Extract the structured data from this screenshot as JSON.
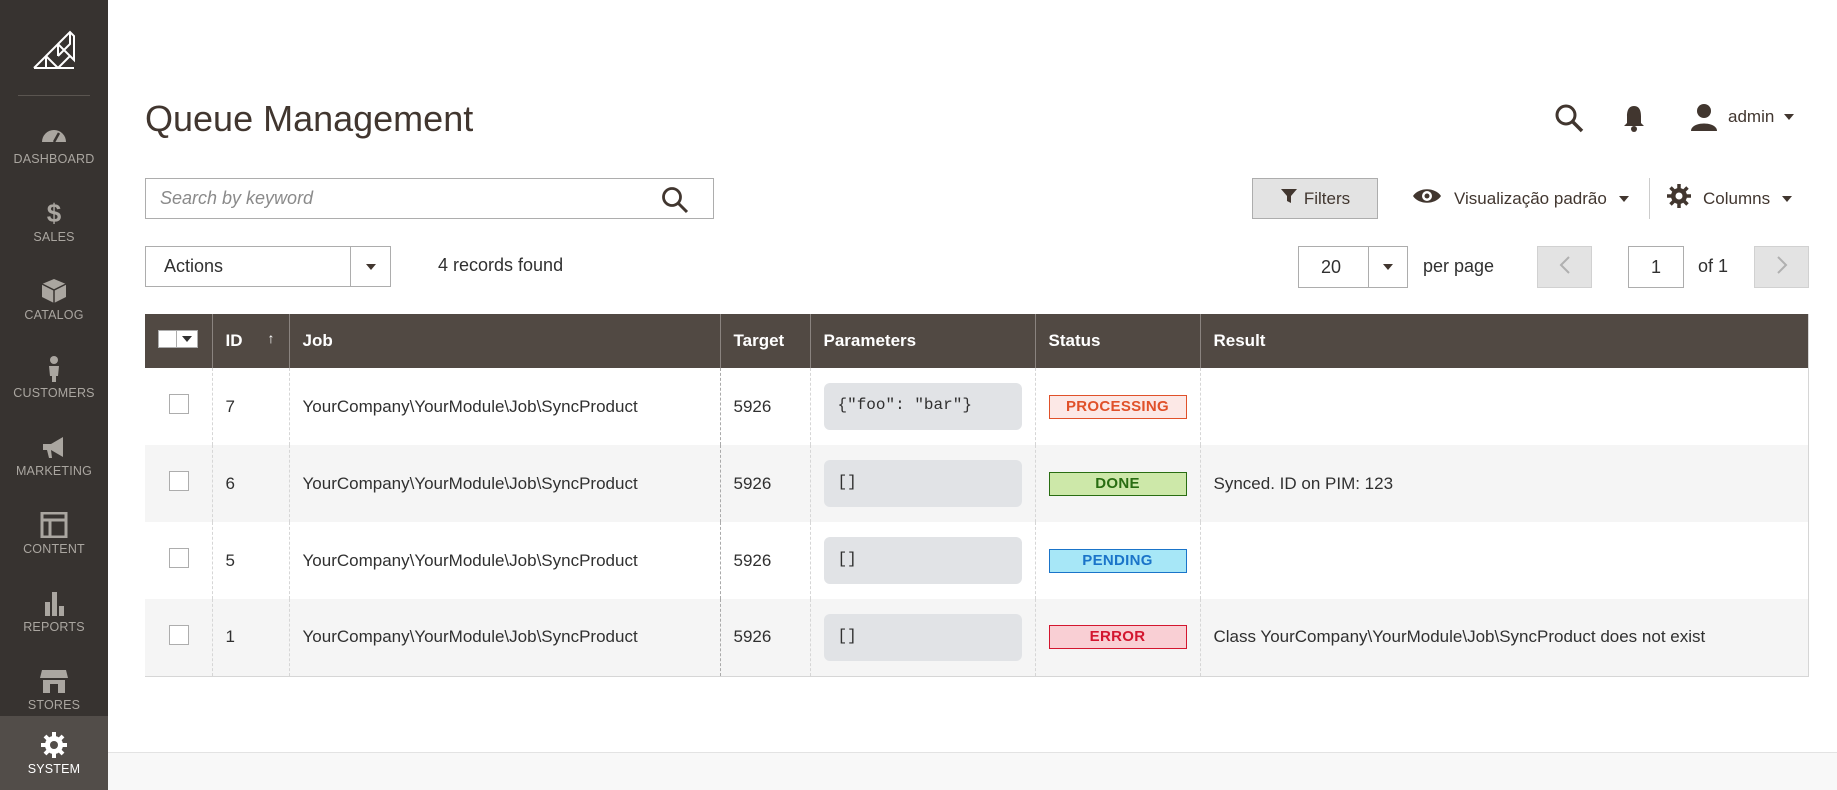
{
  "sidebar": {
    "items": [
      {
        "label": "DASHBOARD",
        "icon": "speedometer-icon"
      },
      {
        "label": "SALES",
        "icon": "dollar-icon"
      },
      {
        "label": "CATALOG",
        "icon": "box-icon"
      },
      {
        "label": "CUSTOMERS",
        "icon": "person-icon"
      },
      {
        "label": "MARKETING",
        "icon": "megaphone-icon"
      },
      {
        "label": "CONTENT",
        "icon": "layout-icon"
      },
      {
        "label": "REPORTS",
        "icon": "bar-chart-icon"
      },
      {
        "label": "STORES",
        "icon": "storefront-icon"
      },
      {
        "label": "SYSTEM",
        "icon": "gear-icon",
        "active": true
      }
    ]
  },
  "header": {
    "title": "Queue Management",
    "user": "admin"
  },
  "toolbar": {
    "search_placeholder": "Search by keyword",
    "filters_label": "Filters",
    "view_label": "Visualização padrão",
    "columns_label": "Columns",
    "actions_label": "Actions",
    "records_found": "4 records found",
    "per_page_value": "20",
    "per_page_label": "per page",
    "page_value": "1",
    "page_of": "of 1"
  },
  "grid": {
    "columns": [
      "ID",
      "Job",
      "Target",
      "Parameters",
      "Status",
      "Result"
    ],
    "rows": [
      {
        "id": "7",
        "job": "YourCompany\\YourModule\\Job\\SyncProduct",
        "target": "5926",
        "params": "{\"foo\": \"bar\"}",
        "status": "PROCESSING",
        "result": ""
      },
      {
        "id": "6",
        "job": "YourCompany\\YourModule\\Job\\SyncProduct",
        "target": "5926",
        "params": "[]",
        "status": "DONE",
        "result": "Synced. ID on PIM: 123"
      },
      {
        "id": "5",
        "job": "YourCompany\\YourModule\\Job\\SyncProduct",
        "target": "5926",
        "params": "[]",
        "status": "PENDING",
        "result": ""
      },
      {
        "id": "1",
        "job": "YourCompany\\YourModule\\Job\\SyncProduct",
        "target": "5926",
        "params": "[]",
        "status": "ERROR",
        "result": "Class YourCompany\\YourModule\\Job\\SyncProduct does not exist"
      }
    ]
  },
  "colors": {
    "sidebar_bg": "#373330",
    "header_bg": "#514943",
    "processing": "#e0512a",
    "done": "#296d12",
    "pending": "#1a74c9",
    "error": "#d3162f"
  }
}
